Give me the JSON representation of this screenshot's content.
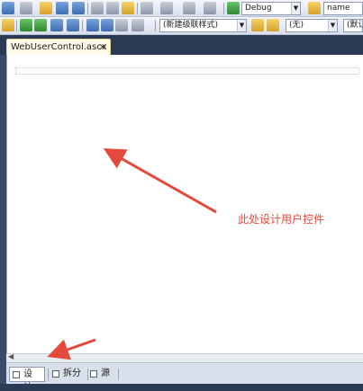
{
  "toolbar": {
    "config_combo": "Debug",
    "target_combo": "name",
    "style_combo": "(新建级联样式)",
    "none_combo": "(无)",
    "default_combo": "(默认"
  },
  "document_tab": {
    "title": "WebUserControl.ascx",
    "close": "×"
  },
  "annotation": {
    "text": "此处设计用户控件",
    "color": "#e34a3b"
  },
  "view_buttons": [
    {
      "label": "设计",
      "active": true
    },
    {
      "label": "拆分",
      "active": false
    },
    {
      "label": "源",
      "active": false
    }
  ]
}
